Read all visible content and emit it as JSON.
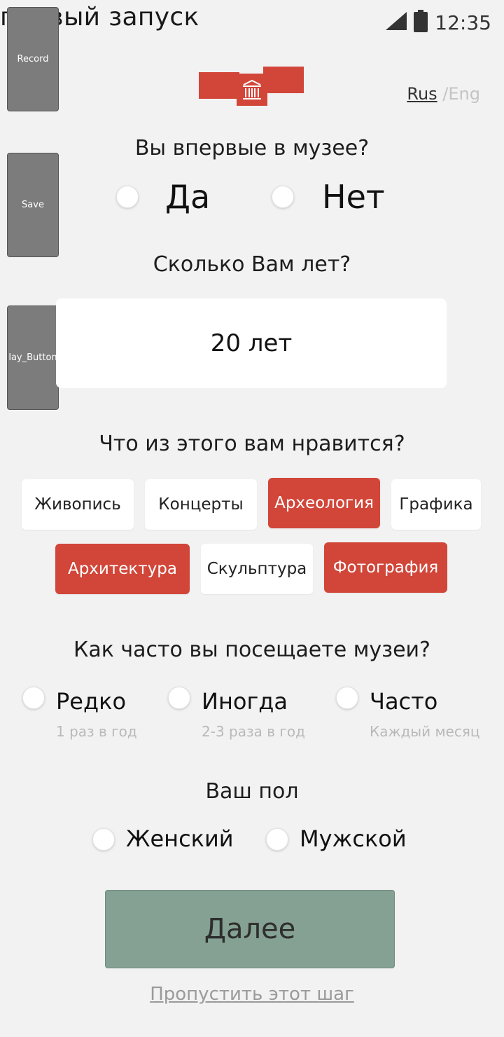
{
  "window": {
    "title": "первый запуск",
    "time": "12:35"
  },
  "side_buttons": [
    {
      "label": "Record"
    },
    {
      "label": "Save"
    },
    {
      "label": "lay_Button"
    }
  ],
  "language": {
    "rus": "Rus",
    "separator": "/",
    "eng": "Eng"
  },
  "first_visit": {
    "question": "Вы впервые в музее?",
    "options": [
      "Да",
      "Нет"
    ]
  },
  "age": {
    "question": "Сколько Вам лет?",
    "value": "20 лет"
  },
  "interests": {
    "question": "Что из этого вам нравится?",
    "chips": [
      {
        "label": "Живопись",
        "selected": false
      },
      {
        "label": "Концерты",
        "selected": false
      },
      {
        "label": "Археология",
        "selected": true
      },
      {
        "label": "Графика",
        "selected": false
      },
      {
        "label": "Архитектура",
        "selected": true
      },
      {
        "label": "Скульптура",
        "selected": false
      },
      {
        "label": "Фотография",
        "selected": true
      }
    ],
    "selected_color": "#d14639"
  },
  "frequency": {
    "question": "Как часто вы посещаете музеи?",
    "options": [
      {
        "label": "Редко",
        "sub": "1 раз в год"
      },
      {
        "label": "Иногда",
        "sub": "2-3 раза в год"
      },
      {
        "label": "Часто",
        "sub": "Каждый месяц"
      }
    ]
  },
  "gender": {
    "question": "Ваш пол",
    "options": [
      "Женский",
      "Мужской"
    ]
  },
  "next_label": "Далее",
  "skip_label": "Пропустить этот шаг",
  "colors": {
    "accent": "#d14639",
    "next_button": "#85a193",
    "background": "#f2f2f2"
  }
}
